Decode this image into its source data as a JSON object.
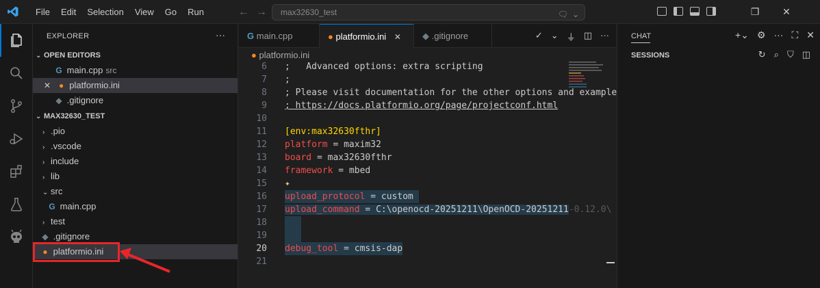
{
  "menu": [
    "File",
    "Edit",
    "Selection",
    "View",
    "Go",
    "Run"
  ],
  "search": {
    "text": "max32630_test"
  },
  "explorer": {
    "title": "EXPLORER",
    "more": "···",
    "open_editors_label": "OPEN EDITORS",
    "open_editors": [
      {
        "name": "main.cpp",
        "hint": "src",
        "type": "cpp"
      },
      {
        "name": "platformio.ini",
        "hint": "",
        "type": "pio"
      },
      {
        "name": ".gitignore",
        "hint": "",
        "type": "git"
      }
    ],
    "project_label": "MAX32630_TEST",
    "tree": [
      {
        "name": ".pio",
        "kind": "folder"
      },
      {
        "name": ".vscode",
        "kind": "folder"
      },
      {
        "name": "include",
        "kind": "folder"
      },
      {
        "name": "lib",
        "kind": "folder"
      },
      {
        "name": "src",
        "kind": "folder-open"
      },
      {
        "name": "main.cpp",
        "kind": "cpp"
      },
      {
        "name": "test",
        "kind": "folder"
      },
      {
        "name": ".gitignore",
        "kind": "git"
      },
      {
        "name": "platformio.ini",
        "kind": "pio"
      }
    ]
  },
  "tabs": [
    {
      "label": "main.cpp",
      "type": "cpp"
    },
    {
      "label": "platformio.ini",
      "type": "pio"
    },
    {
      "label": ".gitignore",
      "type": "git"
    }
  ],
  "breadcrumb": "platformio.ini",
  "code": [
    {
      "n": "6",
      "t": ";   Advanced options: extra scripting"
    },
    {
      "n": "7",
      "t": ";"
    },
    {
      "n": "8",
      "t": "; Please visit documentation for the other options and examples"
    },
    {
      "n": "9",
      "t": "; https://docs.platformio.org/page/projectconf.html"
    },
    {
      "n": "10",
      "t": ""
    },
    {
      "n": "11",
      "t": "[env:max32630fthr]"
    },
    {
      "n": "12",
      "k": "platform",
      "v": "maxim32"
    },
    {
      "n": "13",
      "k": "board",
      "v": "max32630fthr"
    },
    {
      "n": "14",
      "k": "framework",
      "v": "mbed"
    },
    {
      "n": "15",
      "t": ""
    },
    {
      "n": "16",
      "k": "upload_protocol",
      "v": "custom"
    },
    {
      "n": "17",
      "k": "upload_command",
      "v": "C:\\openocd-20251211\\OpenOCD-20251211",
      "ghost": "-0.12.0\\"
    },
    {
      "n": "18",
      "t": ""
    },
    {
      "n": "19",
      "t": ""
    },
    {
      "n": "20",
      "k": "debug_tool",
      "v": "cmsis-dap"
    },
    {
      "n": "21",
      "t": ""
    }
  ],
  "chat": {
    "title": "CHAT",
    "sessions": "SESSIONS"
  }
}
